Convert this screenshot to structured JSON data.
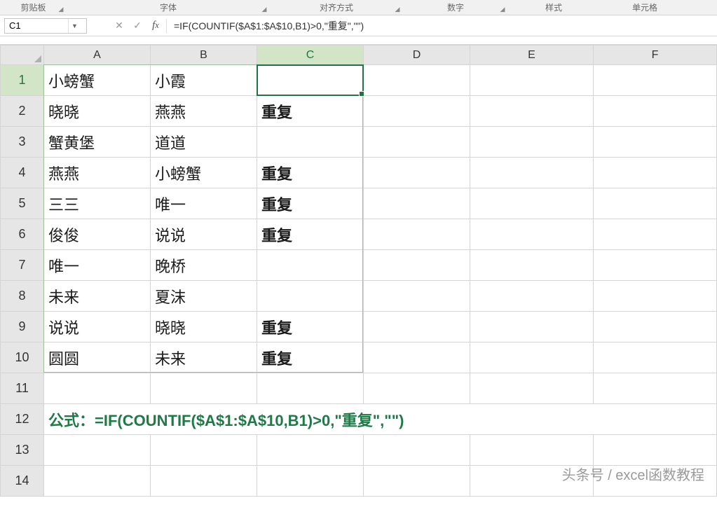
{
  "ribbon": {
    "clipboard": "剪贴板",
    "font": "字体",
    "alignment": "对齐方式",
    "number": "数字",
    "styles": "样式",
    "cells": "单元格"
  },
  "nameBox": {
    "value": "C1"
  },
  "formulaBar": {
    "formula": "=IF(COUNTIF($A$1:$A$10,B1)>0,\"重复\",\"\")"
  },
  "columns": [
    "A",
    "B",
    "C",
    "D",
    "E",
    "F"
  ],
  "rows": {
    "1": {
      "A": "小螃蟹",
      "B": "小霞",
      "C": ""
    },
    "2": {
      "A": "晓晓",
      "B": "燕燕",
      "C": "重复"
    },
    "3": {
      "A": "蟹黄堡",
      "B": "道道",
      "C": ""
    },
    "4": {
      "A": "燕燕",
      "B": "小螃蟹",
      "C": "重复"
    },
    "5": {
      "A": "三三",
      "B": "唯一",
      "C": "重复"
    },
    "6": {
      "A": "俊俊",
      "B": "说说",
      "C": "重复"
    },
    "7": {
      "A": "唯一",
      "B": "晚桥",
      "C": ""
    },
    "8": {
      "A": "未来",
      "B": "夏沫",
      "C": ""
    },
    "9": {
      "A": "说说",
      "B": "晓晓",
      "C": "重复"
    },
    "10": {
      "A": "圆圆",
      "B": "未来",
      "C": "重复"
    },
    "11": {
      "A": "",
      "B": "",
      "C": ""
    },
    "12": {
      "note": "公式：=IF(COUNTIF($A$1:$A$10,B1)>0,\"重复\",\"\")"
    },
    "13": {
      "A": "",
      "B": "",
      "C": ""
    },
    "14": {
      "A": "",
      "B": "",
      "C": ""
    }
  },
  "activeCell": "C1",
  "watermark": "头条号 / excel函数教程"
}
